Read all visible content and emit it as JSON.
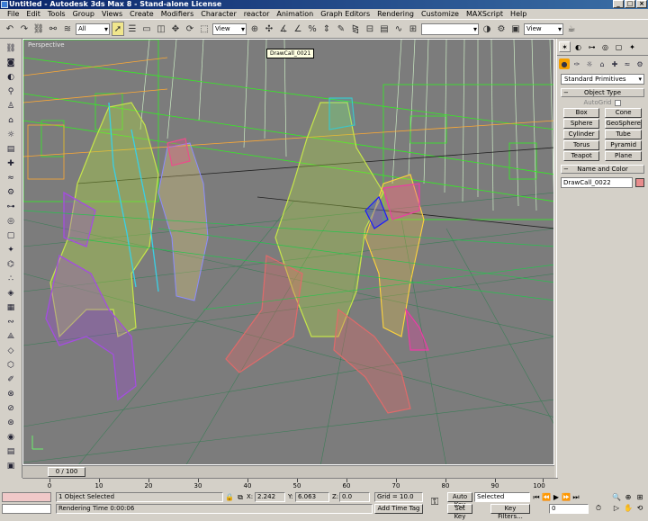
{
  "window": {
    "title": "Untitled - Autodesk 3ds Max 8 - Stand-alone License"
  },
  "menu": [
    "File",
    "Edit",
    "Tools",
    "Group",
    "Views",
    "Create",
    "Modifiers",
    "Character",
    "reactor",
    "Animation",
    "Graph Editors",
    "Rendering",
    "Customize",
    "MAXScript",
    "Help"
  ],
  "toolbar": {
    "selection_filter": "All",
    "ref_coord": "View",
    "named_selection": "",
    "render_dropdown": "View"
  },
  "viewport": {
    "label": "Perspective",
    "tooltip": "DrawCall_0021"
  },
  "timeline": {
    "slider_label": "0 / 100",
    "ticks": [
      "0",
      "10",
      "20",
      "30",
      "40",
      "50",
      "60",
      "70",
      "80",
      "90",
      "100"
    ]
  },
  "command_panel": {
    "category_dropdown": "Standard Primitives",
    "object_type_title": "Object Type",
    "autogrid_label": "AutoGrid",
    "buttons": [
      "Box",
      "Cone",
      "Sphere",
      "GeoSphere",
      "Cylinder",
      "Tube",
      "Torus",
      "Pyramid",
      "Teapot",
      "Plane"
    ],
    "name_color_title": "Name and Color",
    "object_name": "DrawCall_0022",
    "swatch_color": "#e88c8c"
  },
  "status": {
    "selection": "1 Object Selected",
    "prompt": "Rendering Time  0:00:06",
    "x_label": "X:",
    "x_value": "2.242",
    "y_label": "Y:",
    "y_value": "6.063",
    "z_label": "Z:",
    "z_value": "0.0",
    "grid": "Grid = 10.0",
    "add_time_tag": "Add Time Tag",
    "auto_key": "Auto Key",
    "set_key": "Set Key",
    "key_mode_select": "Selected",
    "key_filters": "Key Filters...",
    "frame": "0"
  }
}
